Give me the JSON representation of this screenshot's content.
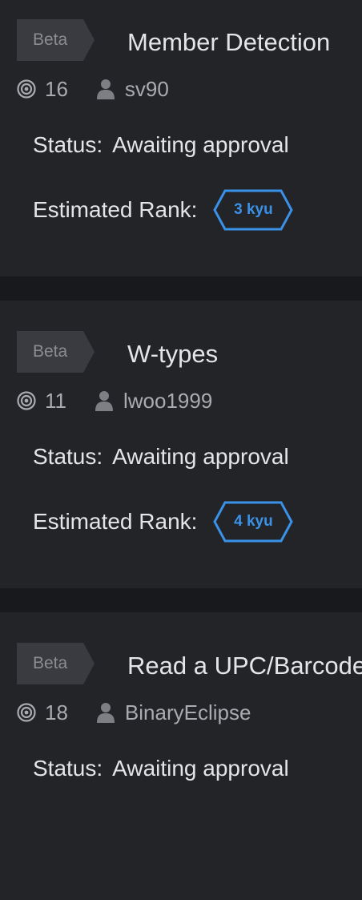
{
  "kata_list": [
    {
      "tag": "Beta",
      "title": "Member Detection",
      "satisfaction": "16",
      "author": "sv90",
      "status_label": "Status:",
      "status_value": "Awaiting approval",
      "rank_label": "Estimated Rank:",
      "rank_value": "3 kyu"
    },
    {
      "tag": "Beta",
      "title": "W-types",
      "satisfaction": "11",
      "author": "lwoo1999",
      "status_label": "Status:",
      "status_value": "Awaiting approval",
      "rank_label": "Estimated Rank:",
      "rank_value": "4 kyu"
    },
    {
      "tag": "Beta",
      "title": "Read a UPC/Barcode",
      "satisfaction": "18",
      "author": "BinaryEclipse",
      "status_label": "Status:",
      "status_value": "Awaiting approval"
    }
  ],
  "colors": {
    "page_background": "#18191c",
    "card_background": "#232428",
    "tag_background": "#3a3b40",
    "rank_blue": "#3a92e8"
  },
  "icons": {
    "satisfaction": "target-icon",
    "author": "user-icon",
    "rank": "hexagon-rank-badge"
  }
}
